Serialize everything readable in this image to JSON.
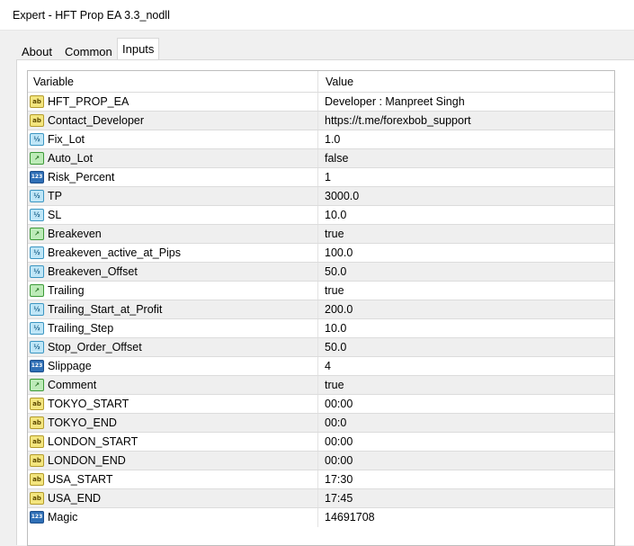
{
  "window": {
    "title": "Expert - HFT Prop EA 3.3_nodll"
  },
  "tabs": [
    {
      "label": "About"
    },
    {
      "label": "Common"
    },
    {
      "label": "Inputs"
    }
  ],
  "table": {
    "columns": {
      "variable": "Variable",
      "value": "Value"
    },
    "rows": [
      {
        "icon": "ab",
        "name": "HFT_PROP_EA",
        "value": "Developer : Manpreet Singh"
      },
      {
        "icon": "ab",
        "name": "Contact_Developer",
        "value": "https://t.me/forexbob_support"
      },
      {
        "icon": "dbl",
        "name": "Fix_Lot",
        "value": "1.0"
      },
      {
        "icon": "bool",
        "name": "Auto_Lot",
        "value": "false"
      },
      {
        "icon": "int",
        "name": "Risk_Percent",
        "value": "1"
      },
      {
        "icon": "dbl",
        "name": "TP",
        "value": "3000.0"
      },
      {
        "icon": "dbl",
        "name": "SL",
        "value": "10.0"
      },
      {
        "icon": "bool",
        "name": "Breakeven",
        "value": "true"
      },
      {
        "icon": "dbl",
        "name": "Breakeven_active_at_Pips",
        "value": "100.0"
      },
      {
        "icon": "dbl",
        "name": "Breakeven_Offset",
        "value": "50.0"
      },
      {
        "icon": "bool",
        "name": "Trailing",
        "value": "true"
      },
      {
        "icon": "dbl",
        "name": "Trailing_Start_at_Profit",
        "value": "200.0"
      },
      {
        "icon": "dbl",
        "name": "Trailing_Step",
        "value": "10.0"
      },
      {
        "icon": "dbl",
        "name": "Stop_Order_Offset",
        "value": "50.0"
      },
      {
        "icon": "int",
        "name": "Slippage",
        "value": "4"
      },
      {
        "icon": "bool",
        "name": "Comment",
        "value": "true"
      },
      {
        "icon": "ab",
        "name": "TOKYO_START",
        "value": "00:00"
      },
      {
        "icon": "ab",
        "name": "TOKYO_END",
        "value": "00:0"
      },
      {
        "icon": "ab",
        "name": "LONDON_START",
        "value": "00:00"
      },
      {
        "icon": "ab",
        "name": "LONDON_END",
        "value": "00:00"
      },
      {
        "icon": "ab",
        "name": "USA_START",
        "value": "17:30"
      },
      {
        "icon": "ab",
        "name": "USA_END",
        "value": "17:45"
      },
      {
        "icon": "int",
        "name": "Magic",
        "value": "14691708"
      }
    ]
  },
  "icon_glyphs": {
    "ab": "ab",
    "dbl": "½",
    "int": "123",
    "bool": "↗"
  }
}
